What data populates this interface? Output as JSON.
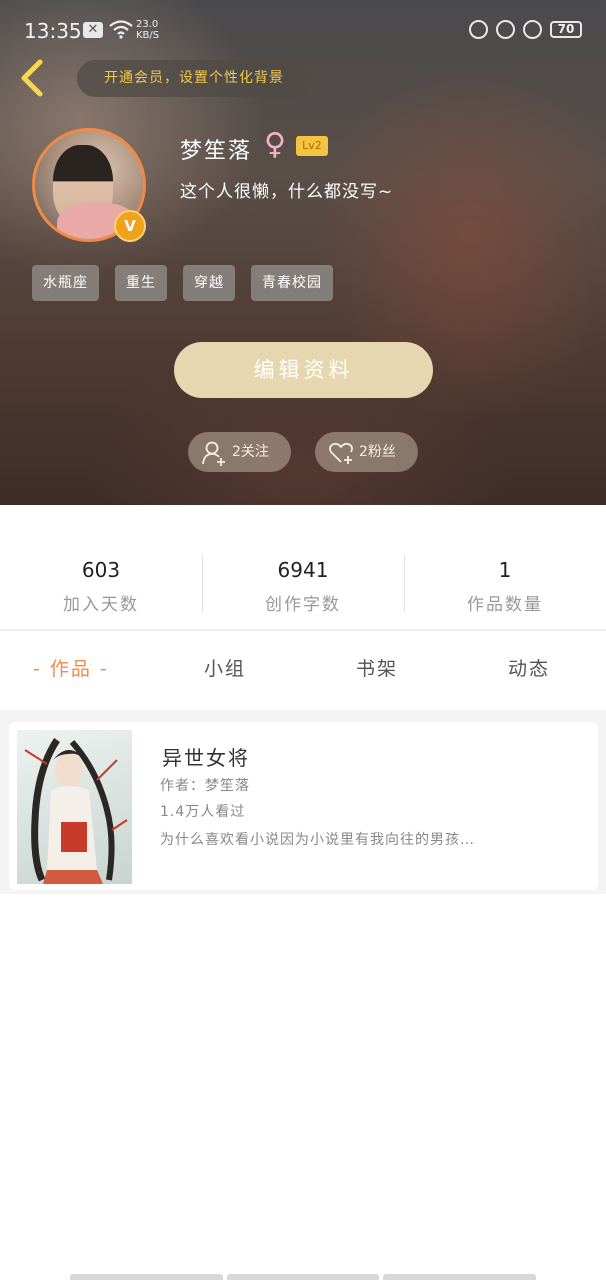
{
  "status_bar": {
    "time": "13:35",
    "network_speed_value": "23.0",
    "network_speed_unit": "KB/S",
    "battery": "70"
  },
  "header": {
    "vip_prompt": "开通会员，设置个性化背景"
  },
  "profile": {
    "name": "梦笙落",
    "gender_symbol": "♀",
    "level": "Lv2",
    "vip_badge": "V",
    "bio": "这个人很懒，什么都没写~",
    "tags": [
      "水瓶座",
      "重生",
      "穿越",
      "青春校园"
    ],
    "edit_button": "编辑资料",
    "following": "2关注",
    "followers": "2粉丝"
  },
  "stats": [
    {
      "value": "603",
      "label": "加入天数"
    },
    {
      "value": "6941",
      "label": "创作字数"
    },
    {
      "value": "1",
      "label": "作品数量"
    }
  ],
  "tabs": [
    {
      "label": "- 作品 -",
      "active": true
    },
    {
      "label": "小组",
      "active": false
    },
    {
      "label": "书架",
      "active": false
    },
    {
      "label": "动态",
      "active": false
    }
  ],
  "works": [
    {
      "title": "异世女将",
      "author": "作者：梦笙落",
      "reads": "1.4万人看过",
      "description": "为什么喜欢看小说因为小说里有我向往的男孩…"
    }
  ],
  "colors": {
    "accent": "#f08c4a",
    "vip_gold": "#f3c84b",
    "edit_button": "#e6d7b0"
  }
}
